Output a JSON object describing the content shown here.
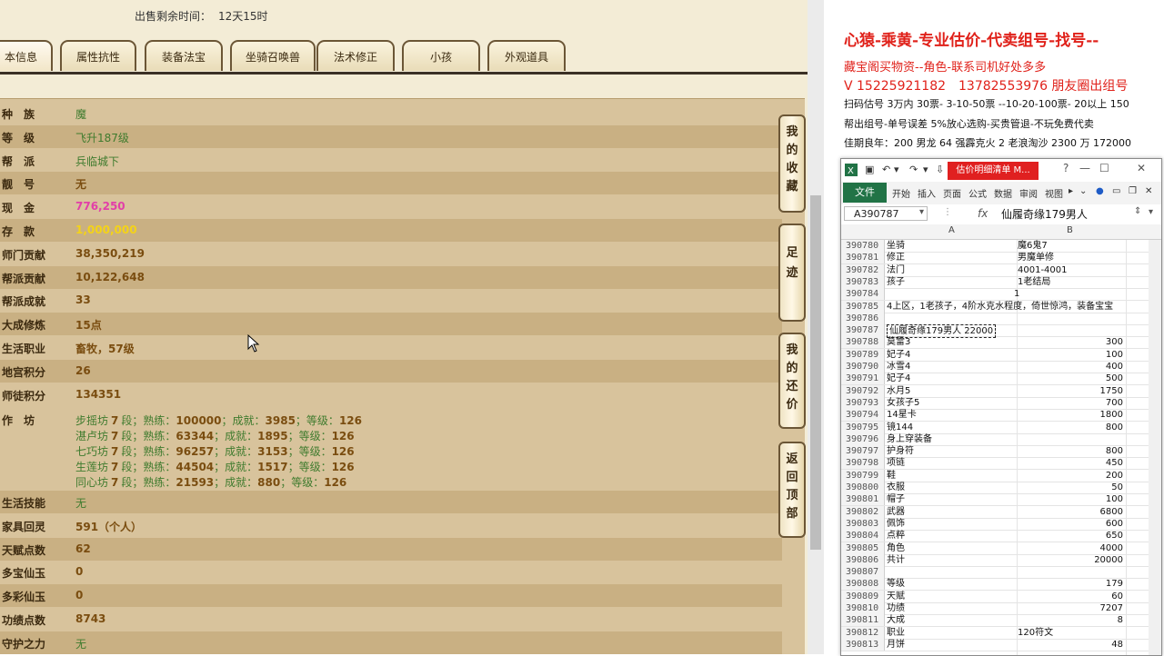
{
  "game": {
    "sale_time_label": "出售剩余时间：",
    "sale_time_value": "12天15时",
    "tabs": [
      "本信息",
      "属性抗性",
      "装备法宝",
      "坐骑召唤兽",
      "法术修正",
      "小孩",
      "外观道具"
    ],
    "info": [
      {
        "label": "种　族",
        "value": "魔",
        "color": "green"
      },
      {
        "label": "等　级",
        "value": "飞升187级",
        "color": "green"
      },
      {
        "label": "帮　派",
        "value": "兵临城下",
        "color": "green"
      },
      {
        "label": "靓　号",
        "value": "无",
        "color": "brown"
      },
      {
        "label": "现　金",
        "value": "776,250",
        "color": "pink"
      },
      {
        "label": "存　款",
        "value": "1,000,000",
        "color": "gold"
      },
      {
        "label": "师门贡献",
        "value": "38,350,219",
        "color": "brown"
      },
      {
        "label": "帮派贡献",
        "value": "10,122,648",
        "color": "brown"
      },
      {
        "label": "帮派成就",
        "value": "33",
        "color": "brown"
      },
      {
        "label": "大成修炼",
        "value": "15点",
        "color": "brown"
      },
      {
        "label": "生活职业",
        "value": "畜牧，57级",
        "color": "brown"
      },
      {
        "label": "地宫积分",
        "value": "26",
        "color": "brown"
      },
      {
        "label": "师徒积分",
        "value": "134351",
        "color": "brown"
      }
    ],
    "workshop_label": "作　坊",
    "workshops": [
      {
        "name": "步摇坊",
        "level": "7",
        "seg": "段；熟练：",
        "proficiency": "100000",
        "ach_label": "；成就：",
        "achievement": "3985",
        "grade_label": "；等级：",
        "grade": "126"
      },
      {
        "name": "湛卢坊",
        "level": "7",
        "seg": "段；熟练：",
        "proficiency": "63344",
        "ach_label": "；成就：",
        "achievement": "1895",
        "grade_label": "；等级：",
        "grade": "126"
      },
      {
        "name": "七巧坊",
        "level": "7",
        "seg": "段；熟练：",
        "proficiency": "96257",
        "ach_label": "；成就：",
        "achievement": "3153",
        "grade_label": "；等级：",
        "grade": "126"
      },
      {
        "name": "生莲坊",
        "level": "7",
        "seg": "段；熟练：",
        "proficiency": "44504",
        "ach_label": "；成就：",
        "achievement": "1517",
        "grade_label": "；等级：",
        "grade": "126"
      },
      {
        "name": "同心坊",
        "level": "7",
        "seg": "段；熟练：",
        "proficiency": "21593",
        "ach_label": "；成就：",
        "achievement": "880",
        "grade_label": "；等级：",
        "grade": "126"
      }
    ],
    "info2": [
      {
        "label": "生活技能",
        "value": "无",
        "color": "green"
      },
      {
        "label": "家具回灵",
        "value": "591（个人）",
        "color": "brown"
      },
      {
        "label": "天赋点数",
        "value": "62",
        "color": "brown"
      },
      {
        "label": "多宝仙玉",
        "value": "0",
        "color": "brown"
      },
      {
        "label": "多彩仙玉",
        "value": "0",
        "color": "brown"
      },
      {
        "label": "功绩点数",
        "value": "8743",
        "color": "brown"
      },
      {
        "label": "守护之力",
        "value": "无",
        "color": "green"
      }
    ],
    "side_buttons": [
      "我的收藏",
      "足迹",
      "我的还价",
      "返回顶部"
    ]
  },
  "notes": {
    "line1": "心猿-乘黄-专业估价-代卖组号-找号--",
    "line2": "藏宝阁买物资--角色-联系司机好处多多",
    "line3": "V 15225921182　13782553976 朋友圈出组号",
    "line4": "扫码估号 3万内 30票- 3-10-50票 --10-20-100票- 20以上 150",
    "line5": "帮出组号-单号误差 5%放心选购-买贵管退-不玩免费代卖",
    "line6": "佳期良年：200 男龙 64 强霹克火 2 老浪淘沙 2300 万 172000"
  },
  "excel": {
    "doc_title": "估价明细清单 M...",
    "ribbon_file": "文件",
    "ribbon_tabs": [
      "开始",
      "插入",
      "页面",
      "公式",
      "数据",
      "审阅",
      "视图"
    ],
    "name_box": "A390787",
    "fx": "fx",
    "formula_value": "仙履奇缘179男人",
    "col_a": "A",
    "col_b": "B",
    "rows": [
      {
        "n": "390780",
        "a": "坐骑",
        "b": "魔6鬼7",
        "num": false
      },
      {
        "n": "390781",
        "a": "修正",
        "b": "男魔单修",
        "num": false
      },
      {
        "n": "390782",
        "a": "法门",
        "b": "4001-4001",
        "num": false
      },
      {
        "n": "390783",
        "a": "孩子",
        "b": "1老结局",
        "num": false
      },
      {
        "n": "390784",
        "a": "　　　　　　　　　　　　　　1",
        "b": "",
        "num": false
      },
      {
        "n": "390785",
        "a": "4上区，1老孩子，4阶水克水程度，倚世惊鸿，装备宝宝",
        "b": "",
        "num": false
      },
      {
        "n": "390786",
        "a": "",
        "b": "",
        "num": false
      },
      {
        "n": "390787",
        "a": "仙履奇缘179男人 22000",
        "b": "",
        "num": false,
        "sel": true
      },
      {
        "n": "390788",
        "a": "莫雷3",
        "b": "300",
        "num": true
      },
      {
        "n": "390789",
        "a": "妃子4",
        "b": "100",
        "num": true
      },
      {
        "n": "390790",
        "a": "冰雪4",
        "b": "400",
        "num": true
      },
      {
        "n": "390791",
        "a": "妃子4",
        "b": "500",
        "num": true
      },
      {
        "n": "390792",
        "a": "水月5",
        "b": "1750",
        "num": true
      },
      {
        "n": "390793",
        "a": "女孩子5",
        "b": "700",
        "num": true
      },
      {
        "n": "390794",
        "a": "14星卡",
        "b": "1800",
        "num": true
      },
      {
        "n": "390795",
        "a": "镜144",
        "b": "800",
        "num": true
      },
      {
        "n": "390796",
        "a": "身上穿装备",
        "b": "",
        "num": false
      },
      {
        "n": "390797",
        "a": "护身符",
        "b": "800",
        "num": true
      },
      {
        "n": "390798",
        "a": "项链",
        "b": "450",
        "num": true
      },
      {
        "n": "390799",
        "a": "鞋",
        "b": "200",
        "num": true
      },
      {
        "n": "390800",
        "a": "衣服",
        "b": "50",
        "num": true
      },
      {
        "n": "390801",
        "a": "帽子",
        "b": "100",
        "num": true
      },
      {
        "n": "390802",
        "a": "武器",
        "b": "6800",
        "num": true
      },
      {
        "n": "390803",
        "a": "佩饰",
        "b": "600",
        "num": true
      },
      {
        "n": "390804",
        "a": "点粹",
        "b": "650",
        "num": true
      },
      {
        "n": "390805",
        "a": "角色",
        "b": "4000",
        "num": true
      },
      {
        "n": "390806",
        "a": "共计",
        "b": "20000",
        "num": true
      },
      {
        "n": "390807",
        "a": "",
        "b": "",
        "num": false
      },
      {
        "n": "390808",
        "a": "等级",
        "b": "179",
        "num": true
      },
      {
        "n": "390809",
        "a": "天赋",
        "b": "60",
        "num": true
      },
      {
        "n": "390810",
        "a": "功绩",
        "b": "7207",
        "num": true
      },
      {
        "n": "390811",
        "a": "大成",
        "b": "8",
        "num": true
      },
      {
        "n": "390812",
        "a": "职业",
        "b": "120符文",
        "num": false
      },
      {
        "n": "390813",
        "a": "月饼",
        "b": "48",
        "num": true
      }
    ]
  }
}
